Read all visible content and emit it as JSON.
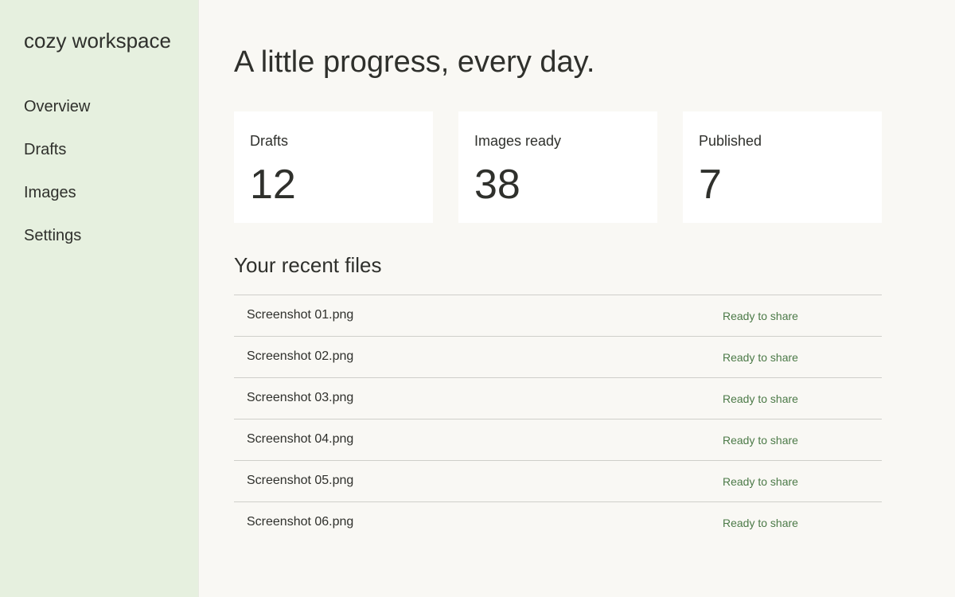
{
  "sidebar": {
    "brand": "cozy workspace",
    "items": [
      {
        "label": "Overview"
      },
      {
        "label": "Drafts"
      },
      {
        "label": "Images"
      },
      {
        "label": "Settings"
      }
    ]
  },
  "main": {
    "headline": "A little progress, every day.",
    "stats": [
      {
        "label": "Drafts",
        "value": "12"
      },
      {
        "label": "Images ready",
        "value": "38"
      },
      {
        "label": "Published",
        "value": "7"
      }
    ],
    "recent_title": "Your recent files",
    "files": [
      {
        "name": "Screenshot 01.png",
        "status": "Ready to share"
      },
      {
        "name": "Screenshot 02.png",
        "status": "Ready to share"
      },
      {
        "name": "Screenshot 03.png",
        "status": "Ready to share"
      },
      {
        "name": "Screenshot 04.png",
        "status": "Ready to share"
      },
      {
        "name": "Screenshot 05.png",
        "status": "Ready to share"
      },
      {
        "name": "Screenshot 06.png",
        "status": "Ready to share"
      }
    ]
  },
  "colors": {
    "sidebar_bg": "#e6f0df",
    "page_bg": "#f9f8f4",
    "card_bg": "#ffffff",
    "status_green": "#4c7a48",
    "text": "#2f302c"
  }
}
